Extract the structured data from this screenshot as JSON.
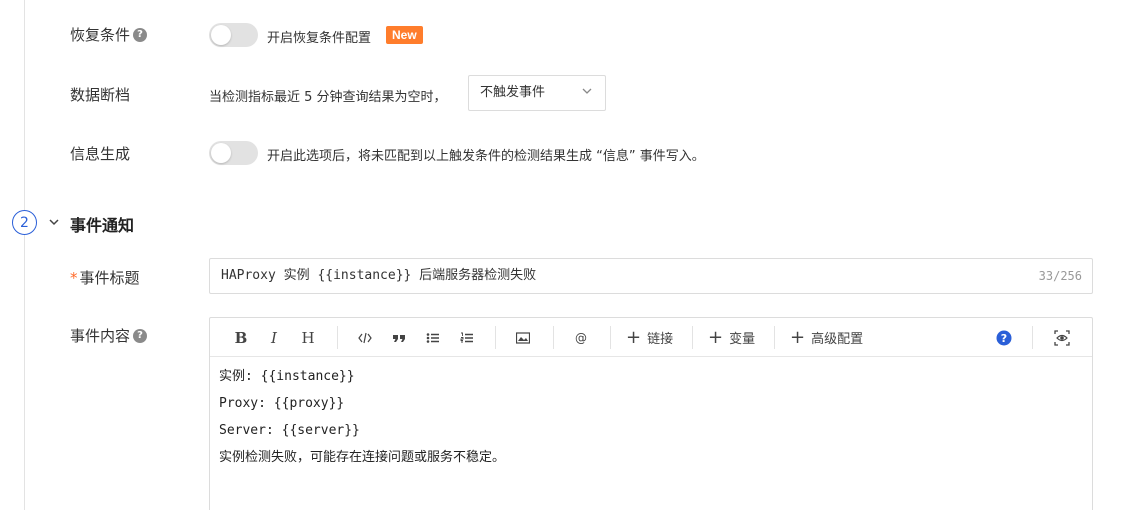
{
  "recovery": {
    "label": "恢复条件",
    "toggle_text": "开启恢复条件配置",
    "badge": "New"
  },
  "data_gap": {
    "label": "数据断档",
    "text": "当检测指标最近 5 分钟查询结果为空时，",
    "select_value": "不触发事件"
  },
  "info_gen": {
    "label": "信息生成",
    "text": "开启此选项后，将未匹配到以上触发条件的检测结果生成 “信息” 事件写入。"
  },
  "section": {
    "step": "2",
    "title": "事件通知"
  },
  "event_title": {
    "required_mark": "*",
    "label": "事件标题",
    "value": "HAProxy 实例 {{instance}} 后端服务器检测失败",
    "count": "33/256"
  },
  "event_content": {
    "label": "事件内容",
    "toolbar": {
      "bold": "B",
      "italic": "I",
      "heading": "H",
      "link_label": "链接",
      "var_label": "变量",
      "advanced_label": "高级配置"
    },
    "lines": [
      "实例: {{instance}}",
      "Proxy: {{proxy}}",
      "Server: {{server}}",
      "实例检测失败，可能存在连接问题或服务不稳定。"
    ]
  },
  "colors": {
    "accent": "#2a5fd8",
    "badge": "#ff7d2c",
    "required": "#ff6b2c"
  }
}
